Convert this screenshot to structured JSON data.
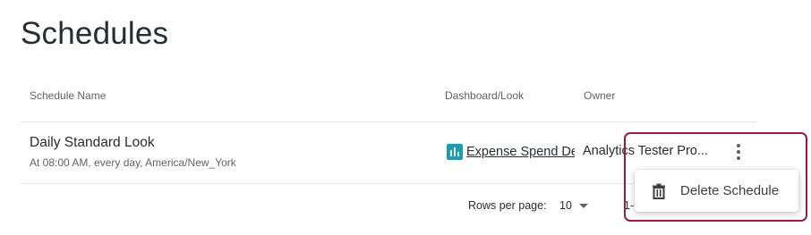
{
  "page": {
    "title": "Schedules"
  },
  "table": {
    "columns": {
      "schedule_name": "Schedule Name",
      "dashboard_look": "Dashboard/Look",
      "owner": "Owner"
    },
    "rows": [
      {
        "name": "Daily Standard Look",
        "description": "At 08:00 AM, every day, America/New_York",
        "dashboard": {
          "icon": "chart-bar-icon",
          "label": "Expense Spend Det"
        },
        "owner": "Analytics Tester Pro...",
        "actions_icon": "more-vert-icon"
      }
    ]
  },
  "pagination": {
    "rows_per_page_label": "Rows per page:",
    "rows_per_page_value": "10",
    "range_text": "1-"
  },
  "context_menu": {
    "items": [
      {
        "icon": "trash-icon",
        "label": "Delete Schedule"
      }
    ]
  },
  "colors": {
    "highlight_border": "#9e1a3f",
    "dashboard_icon": "#19a0b0"
  }
}
